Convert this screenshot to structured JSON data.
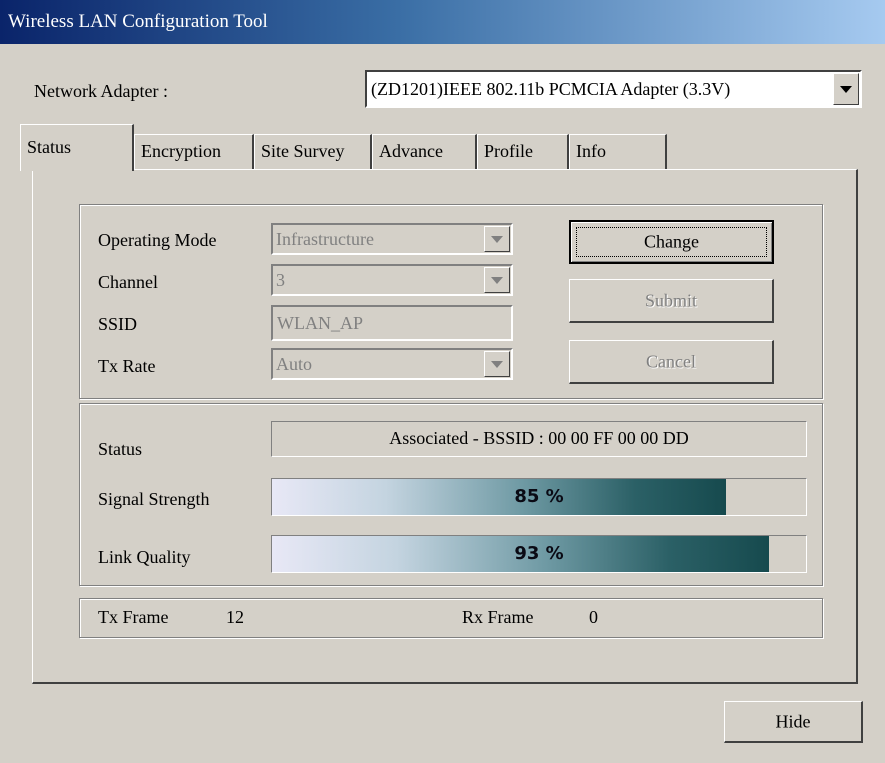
{
  "window": {
    "title": "Wireless LAN Configuration Tool"
  },
  "adapter": {
    "label": "Network Adapter :",
    "selected": "(ZD1201)IEEE 802.11b PCMCIA Adapter (3.3V)"
  },
  "tabs": [
    {
      "label": "Status",
      "active": true
    },
    {
      "label": "Encryption",
      "active": false
    },
    {
      "label": "Site Survey",
      "active": false
    },
    {
      "label": "Advance",
      "active": false
    },
    {
      "label": "Profile",
      "active": false
    },
    {
      "label": "Info",
      "active": false
    }
  ],
  "config": {
    "operating_mode_label": "Operating Mode",
    "operating_mode_value": "Infrastructure",
    "channel_label": "Channel",
    "channel_value": "3",
    "ssid_label": "SSID",
    "ssid_value": "WLAN_AP",
    "tx_rate_label": "Tx Rate",
    "tx_rate_value": "Auto",
    "change_label": "Change",
    "submit_label": "Submit",
    "cancel_label": "Cancel"
  },
  "status": {
    "status_label": "Status",
    "status_value": "Associated - BSSID : 00 00 FF 00 00 DD",
    "signal_label": "Signal Strength",
    "signal_percent": 85,
    "signal_text": "85 %",
    "link_label": "Link Quality",
    "link_percent": 93,
    "link_text": "93 %"
  },
  "frames": {
    "tx_label": "Tx Frame",
    "tx_value": "12",
    "rx_label": "Rx Frame",
    "rx_value": "0"
  },
  "hide_label": "Hide"
}
